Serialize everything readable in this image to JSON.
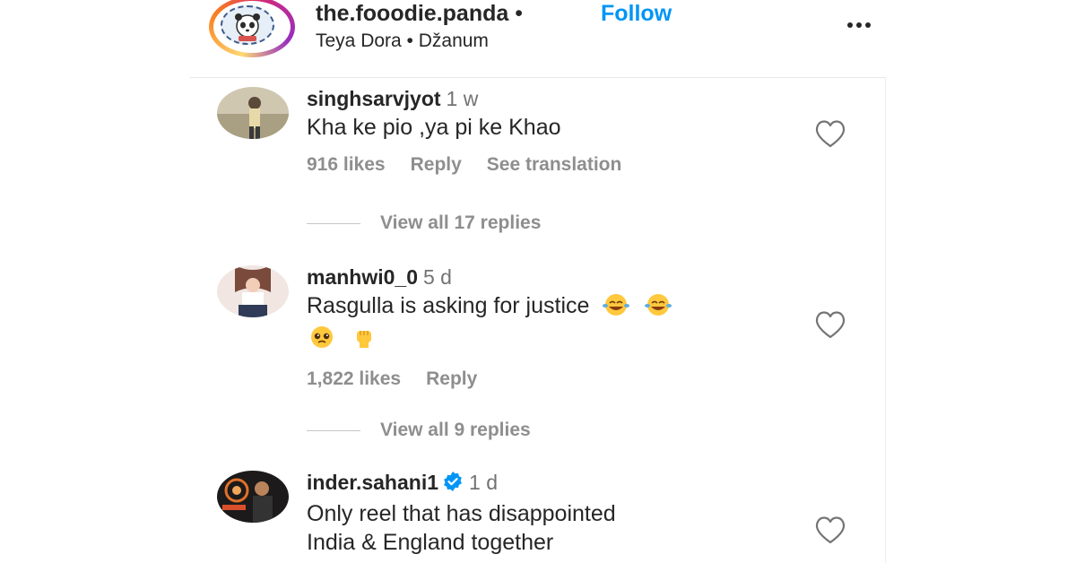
{
  "header": {
    "account": "the.fooodie.panda",
    "separator": "•",
    "follow_label": "Follow",
    "audio": "Teya Dora • Džanum",
    "more_icon": "more-horizontal-icon"
  },
  "comments": [
    {
      "username": "singhsarvjyot",
      "time": "1 w",
      "text": "Kha ke pio ,ya pi ke Khao",
      "likes": "916 likes",
      "reply_label": "Reply",
      "translation_label": "See translation",
      "view_replies": "View all 17 replies"
    },
    {
      "username": "manhwi0_0",
      "time": "5 d",
      "text": "Rasgulla is asking for justice",
      "likes": "1,822 likes",
      "reply_label": "Reply",
      "view_replies": "View all 9 replies"
    },
    {
      "username": "inder.sahani1",
      "time": "1 d",
      "verified": true,
      "text_line1": "Only reel that has disappointed",
      "text_line2": "India & England together"
    }
  ],
  "colors": {
    "follow": "#0095f6",
    "text": "#262626",
    "muted": "#8e8e8e",
    "verified": "#0095f6"
  }
}
